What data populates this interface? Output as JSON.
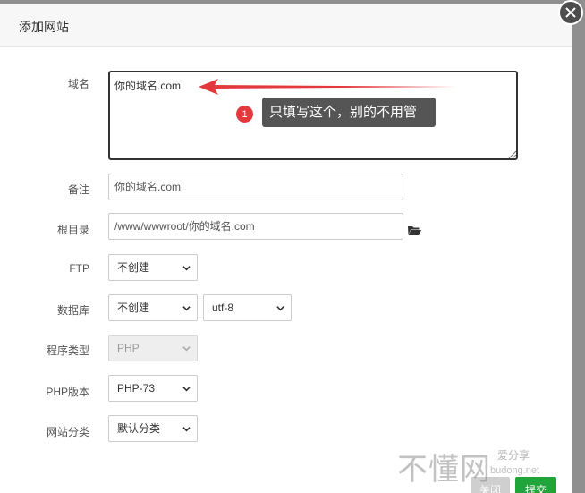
{
  "dialog": {
    "title": "添加网站",
    "close_icon": "close-x-icon"
  },
  "form": {
    "domain": {
      "label": "域名",
      "value": "你的域名.com"
    },
    "remark": {
      "label": "备注",
      "value": "你的域名.com"
    },
    "root_dir": {
      "label": "根目录",
      "value": "/www/wwwroot/你的域名.com",
      "icon": "folder-open-icon"
    },
    "ftp": {
      "label": "FTP",
      "selected": "不创建"
    },
    "database": {
      "label": "数据库",
      "selected": "不创建",
      "charset": "utf-8"
    },
    "program_type": {
      "label": "程序类型",
      "selected": "PHP",
      "disabled": true
    },
    "php_version": {
      "label": "PHP版本",
      "selected": "PHP-73"
    },
    "site_category": {
      "label": "网站分类",
      "selected": "默认分类"
    }
  },
  "annotation": {
    "badge_number": "1",
    "tooltip_text": "只填写这个，别的不用管",
    "arrow_color": "#e4393c"
  },
  "buttons": {
    "close_label": "关闭",
    "submit_label": "提交"
  },
  "watermark": {
    "main": "不懂网",
    "small": "爱分享",
    "url": "budong.net"
  },
  "colors": {
    "accent_green": "#20a53a",
    "badge_red": "#e4393c",
    "tooltip_bg": "#555555"
  }
}
